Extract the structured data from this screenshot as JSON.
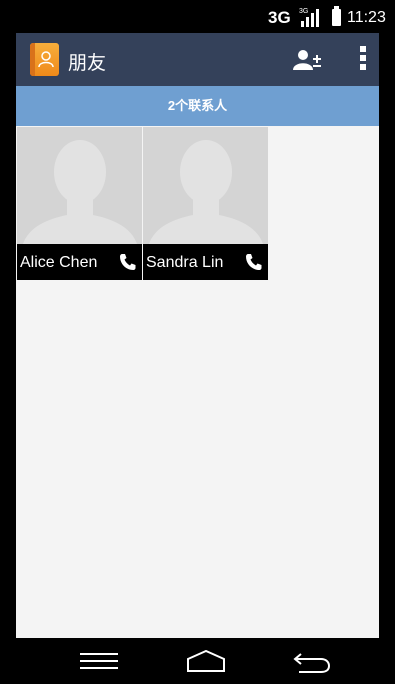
{
  "status_bar": {
    "network": "3G",
    "signal_label": "3G",
    "time": "11:23"
  },
  "action_bar": {
    "title": "朋友",
    "app_icon": "contacts-book-icon",
    "add_contact_icon": "add-contact-icon",
    "overflow_icon": "overflow-menu-icon"
  },
  "contacts": {
    "count_label": "2个联系人",
    "items": [
      {
        "name": "Alice Chen",
        "photo": "default-avatar",
        "action_icon": "phone-icon"
      },
      {
        "name": "Sandra Lin",
        "photo": "default-avatar",
        "action_icon": "phone-icon"
      }
    ]
  },
  "nav_bar": {
    "menu_icon": "menu-icon",
    "home_icon": "home-icon",
    "back_icon": "back-icon"
  },
  "colors": {
    "action_bar": "#34415a",
    "count_bar": "#6f9fd1",
    "content_bg": "#f4f4f4",
    "app_icon": "#f0961f"
  }
}
